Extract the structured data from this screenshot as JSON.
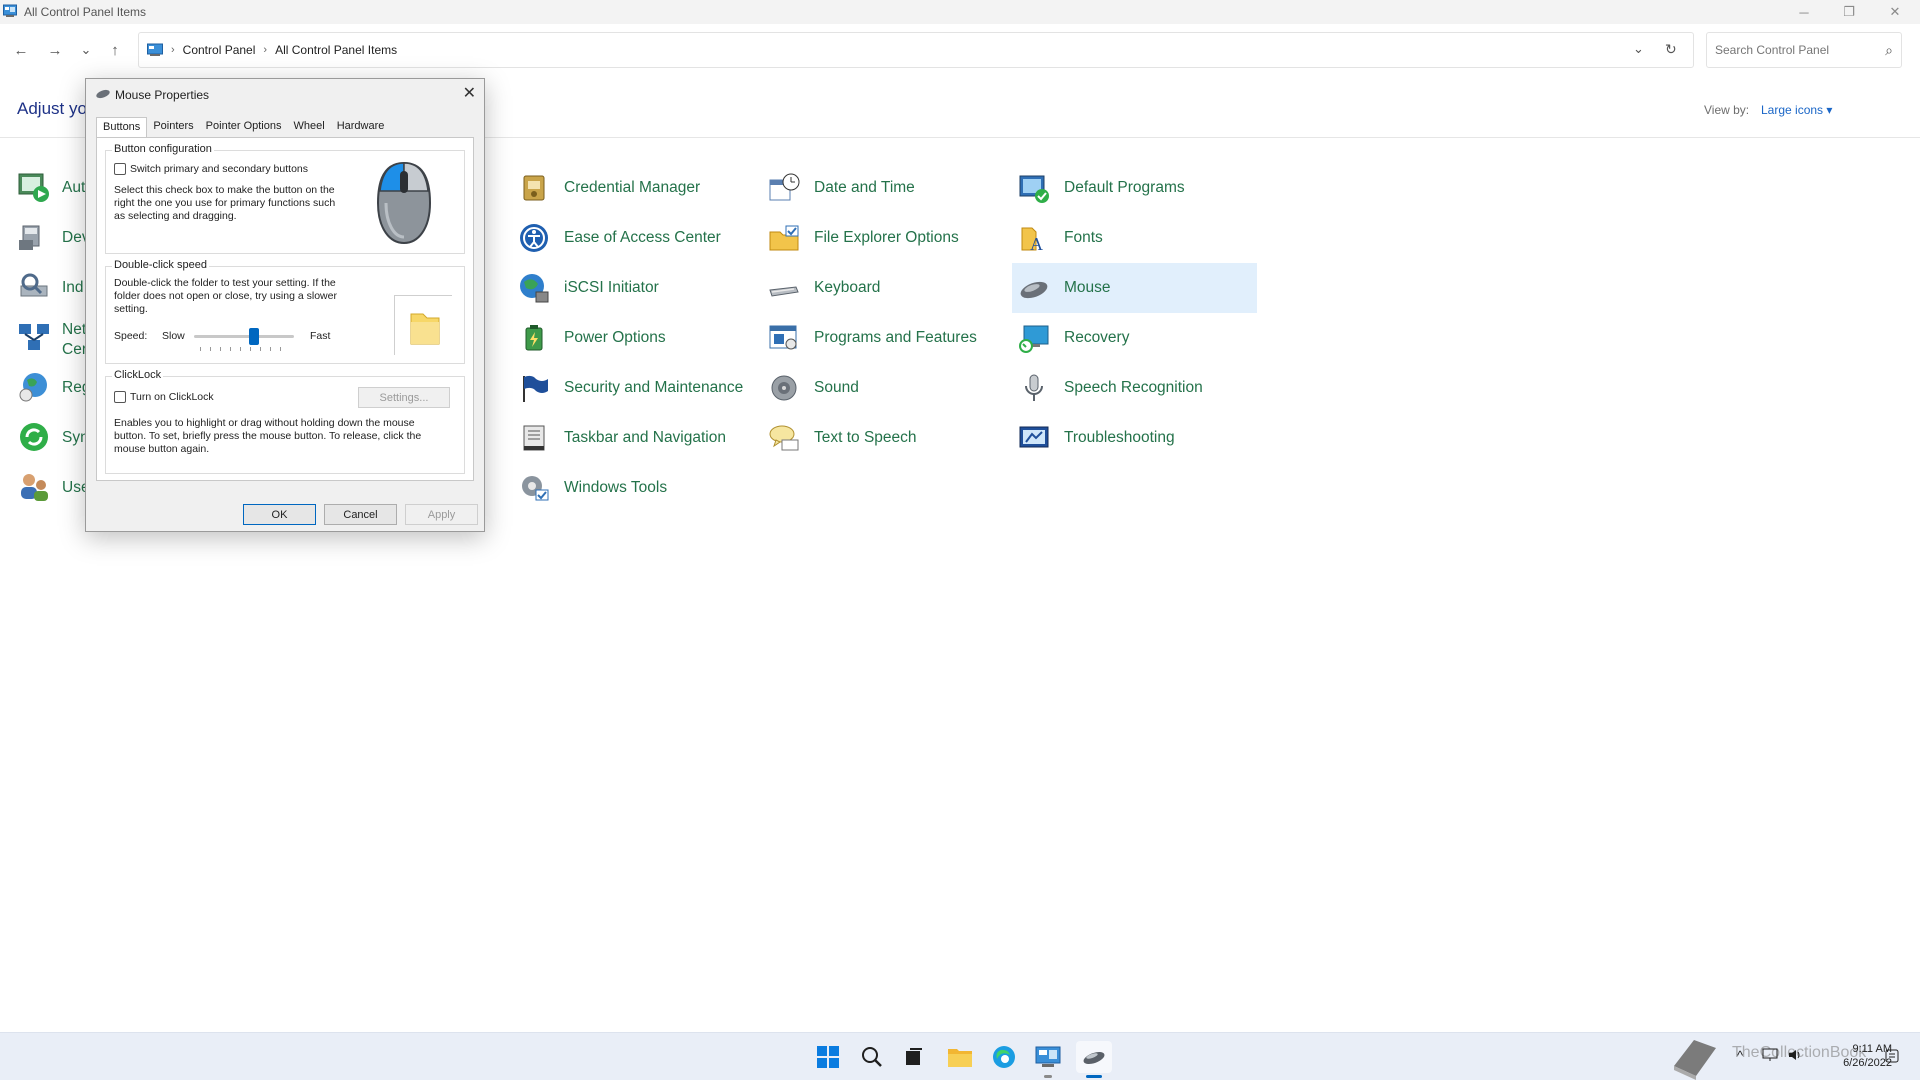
{
  "window": {
    "title": "All Control Panel Items",
    "controls": {
      "minimize": "─",
      "restore": "❐",
      "close": "✕"
    }
  },
  "nav": {
    "back": "←",
    "forward": "→",
    "recent": "⌄",
    "up": "↑",
    "breadcrumbs": [
      "Control Panel",
      "All Control Panel Items"
    ],
    "separator": "›",
    "dropdown": "⌄",
    "refresh": "↻",
    "search_placeholder": "Search Control Panel",
    "search_icon": "⌕"
  },
  "heading": "Adjust yo",
  "view_by": {
    "label": "View by:",
    "value": "Large icons ▾"
  },
  "left_column_items": [
    "Aut",
    "Dev",
    "Ind",
    "Net",
    "Cer",
    "Reg",
    "Syn",
    "Use"
  ],
  "items_col2": [
    {
      "label": "Credential Manager",
      "icon": "credential-manager-icon"
    },
    {
      "label": "Ease of Access Center",
      "icon": "ease-of-access-icon"
    },
    {
      "label": "iSCSI Initiator",
      "icon": "iscsi-icon"
    },
    {
      "label": "Power Options",
      "icon": "power-options-icon"
    },
    {
      "label": "Security and Maintenance",
      "icon": "security-flag-icon"
    },
    {
      "label": "Taskbar and Navigation",
      "icon": "taskbar-icon"
    },
    {
      "label": "Windows Tools",
      "icon": "windows-tools-icon"
    }
  ],
  "items_col3": [
    {
      "label": "Date and Time",
      "icon": "date-time-icon"
    },
    {
      "label": "File Explorer Options",
      "icon": "folder-options-icon"
    },
    {
      "label": "Keyboard",
      "icon": "keyboard-icon"
    },
    {
      "label": "Programs and Features",
      "icon": "programs-icon"
    },
    {
      "label": "Sound",
      "icon": "sound-icon"
    },
    {
      "label": "Text to Speech",
      "icon": "speech-bubble-icon"
    }
  ],
  "items_col4": [
    {
      "label": "Default Programs",
      "icon": "default-programs-icon"
    },
    {
      "label": "Fonts",
      "icon": "fonts-icon"
    },
    {
      "label": "Mouse",
      "icon": "mouse-icon",
      "selected": true
    },
    {
      "label": "Recovery",
      "icon": "recovery-icon"
    },
    {
      "label": "Speech Recognition",
      "icon": "microphone-icon"
    },
    {
      "label": "Troubleshooting",
      "icon": "troubleshooting-icon"
    }
  ],
  "dialog": {
    "title": "Mouse Properties",
    "close": "✕",
    "tabs": [
      "Buttons",
      "Pointers",
      "Pointer Options",
      "Wheel",
      "Hardware"
    ],
    "active_tab": "Buttons",
    "button_config": {
      "title": "Button configuration",
      "checkbox_label": "Switch primary and secondary buttons",
      "checked": false,
      "description": "Select this check box to make the button on the right the one you use for primary functions such as selecting and dragging."
    },
    "double_click": {
      "title": "Double-click speed",
      "description": "Double-click the folder to test your setting. If the folder does not open or close, try using a slower setting.",
      "speed_label": "Speed:",
      "slow": "Slow",
      "fast": "Fast",
      "slider_fraction": 0.6
    },
    "clicklock": {
      "title": "ClickLock",
      "checkbox_label": "Turn on ClickLock",
      "checked": false,
      "settings_button": "Settings...",
      "description": "Enables you to highlight or drag without holding down the mouse button. To set, briefly press the mouse button. To release, click the mouse button again."
    },
    "buttons": {
      "ok": "OK",
      "cancel": "Cancel",
      "apply": "Apply"
    }
  },
  "taskbar": {
    "time": "9:11 AM",
    "date": "6/26/2022",
    "watermark": "TheCollectionBook"
  },
  "colors": {
    "link_green": "#24724a",
    "accent_blue": "#0067c0",
    "selected_bg": "#e1effc"
  }
}
